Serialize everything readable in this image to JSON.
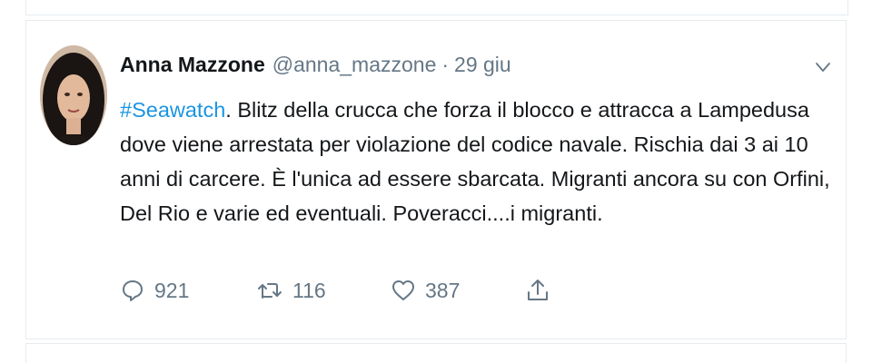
{
  "tweet": {
    "author_name": "Anna Mazzone",
    "author_handle": "@anna_mazzone",
    "separator": "·",
    "date": "29 giu",
    "hashtag": "#Seawatch",
    "text": ". Blitz della crucca che forza il blocco e attracca a Lampedusa dove viene arrestata per violazione del codice navale. Rischia dai 3 ai 10 anni di carcere. È l'unica ad essere sbarcata. Migranti ancora su con Orfini, Del Rio e varie ed eventuali. Poveracci....i migranti.",
    "replies": "921",
    "retweets": "116",
    "likes": "387"
  },
  "icons": {
    "menu": "chevron-down-icon",
    "reply": "reply-bubble-icon",
    "retweet": "retweet-icon",
    "like": "heart-icon",
    "share": "share-upload-icon"
  },
  "colors": {
    "hashtag": "#1b95e0",
    "secondary_text": "#657786",
    "primary_text": "#14171a",
    "border": "#e6ecf0"
  }
}
